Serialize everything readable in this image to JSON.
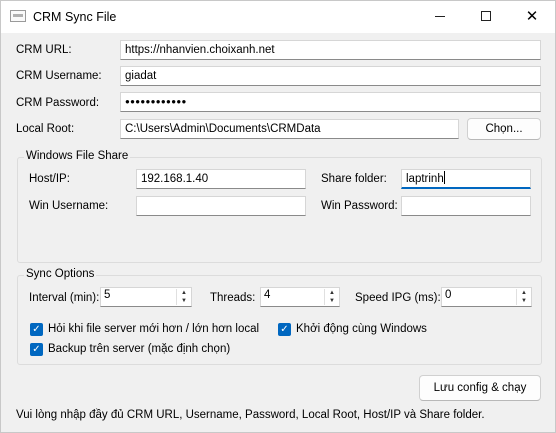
{
  "window": {
    "title": "CRM Sync File",
    "minimize_glyph": "",
    "close_glyph": "✕"
  },
  "crm": {
    "url_label": "CRM URL:",
    "url_value": "https://nhanvien.choixanh.net",
    "username_label": "CRM Username:",
    "username_value": "giadat",
    "password_label": "CRM Password:",
    "password_value": "●●●●●●●●●●●●",
    "local_root_label": "Local Root:",
    "local_root_value": "C:\\Users\\Admin\\Documents\\CRMData",
    "choose_button": "Chọn..."
  },
  "share": {
    "group_title": "Windows File Share",
    "host_label": "Host/IP:",
    "host_value": "192.168.1.40",
    "folder_label": "Share folder:",
    "folder_value": "laptrinh",
    "win_user_label": "Win Username:",
    "win_user_value": "",
    "win_pass_label": "Win Password:",
    "win_pass_value": ""
  },
  "sync": {
    "group_title": "Sync Options",
    "interval_label": "Interval (min):",
    "interval_value": "5",
    "threads_label": "Threads:",
    "threads_value": "4",
    "speed_label": "Speed IPG (ms):",
    "speed_value": "0",
    "ask_label": "Hỏi khi file server mới hơn / lớn hơn local",
    "ask_checked": true,
    "startup_label": "Khởi động cùng Windows",
    "startup_checked": true,
    "backup_label": "Backup trên server (mặc định chọn)",
    "backup_checked": true
  },
  "actions": {
    "save_run_button": "Lưu config & chạy"
  },
  "status": {
    "message": "Vui lòng nhập đầy đủ CRM URL, Username, Password, Local Root, Host/IP và Share folder."
  },
  "colors": {
    "accent": "#0067c0",
    "background": "#f0f0f0"
  }
}
